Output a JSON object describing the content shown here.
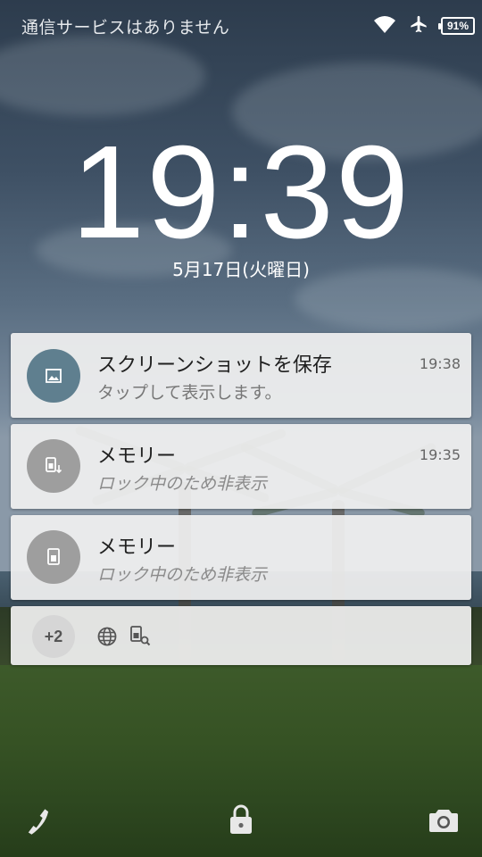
{
  "status_bar": {
    "carrier_text": "通信サービスはありません",
    "battery_percent": "91%"
  },
  "lockscreen": {
    "time": "19:39",
    "date": "5月17日(火曜日)"
  },
  "notifications": [
    {
      "title": "スクリーンショットを保存",
      "subtitle": "タップして表示します。",
      "time": "19:38",
      "icon": "image-icon",
      "color": "#5f7f8f"
    },
    {
      "title": "メモリー",
      "subtitle": "ロック中のため非表示",
      "time": "19:35",
      "icon": "memory-download-icon",
      "color": "#9e9e9e"
    },
    {
      "title": "メモリー",
      "subtitle": "ロック中のため非表示",
      "time": "",
      "icon": "memory-icon",
      "color": "#9e9e9e"
    }
  ],
  "overflow": {
    "count": "+2",
    "icons": [
      "globe-icon",
      "device-search-icon"
    ]
  },
  "bottom_bar": {
    "icons": [
      "phone-icon",
      "lock-icon",
      "camera-icon"
    ]
  }
}
